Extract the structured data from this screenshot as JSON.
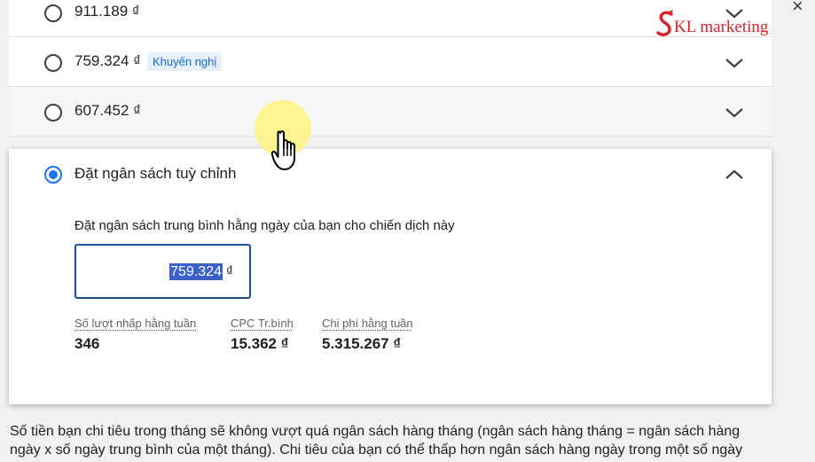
{
  "options": [
    {
      "label": "911.189 ₫",
      "selected": false
    },
    {
      "label": "759.324 ₫",
      "badge": "Khuyến nghị",
      "selected": false
    },
    {
      "label": "607.452 ₫",
      "selected": false
    }
  ],
  "custom": {
    "label": "Đặt ngân sách tuỳ chỉnh",
    "selected": true,
    "prompt": "Đặt ngân sách trung bình hằng ngày của bạn cho chiến dịch này",
    "budget_value": "759.324",
    "currency": "₫",
    "stats": [
      {
        "label": "Số lượt nhấp hằng tuần",
        "value": "346"
      },
      {
        "label": "CPC Tr.bình",
        "value": "15.362 ₫"
      },
      {
        "label": "Chi phí hằng tuần",
        "value": "5.315.267 ₫"
      }
    ]
  },
  "footer": {
    "line1": "Số tiền bạn chi tiêu trong tháng sẽ không vượt quá ngân sách hàng tháng (ngân sách hàng tháng = ngân sách hàng",
    "line2": "ngày x số ngày trung bình của một tháng). Chi tiêu của bạn có thể thấp hơn ngân sách hàng ngày trong một số ngày"
  },
  "logo": {
    "text": "KL marketing",
    "color": "#d4242b"
  },
  "close_glyph": "×",
  "colors": {
    "accent": "#1a73e8",
    "selection": "#3b60c9",
    "badge_bg": "#e8f0fe"
  }
}
